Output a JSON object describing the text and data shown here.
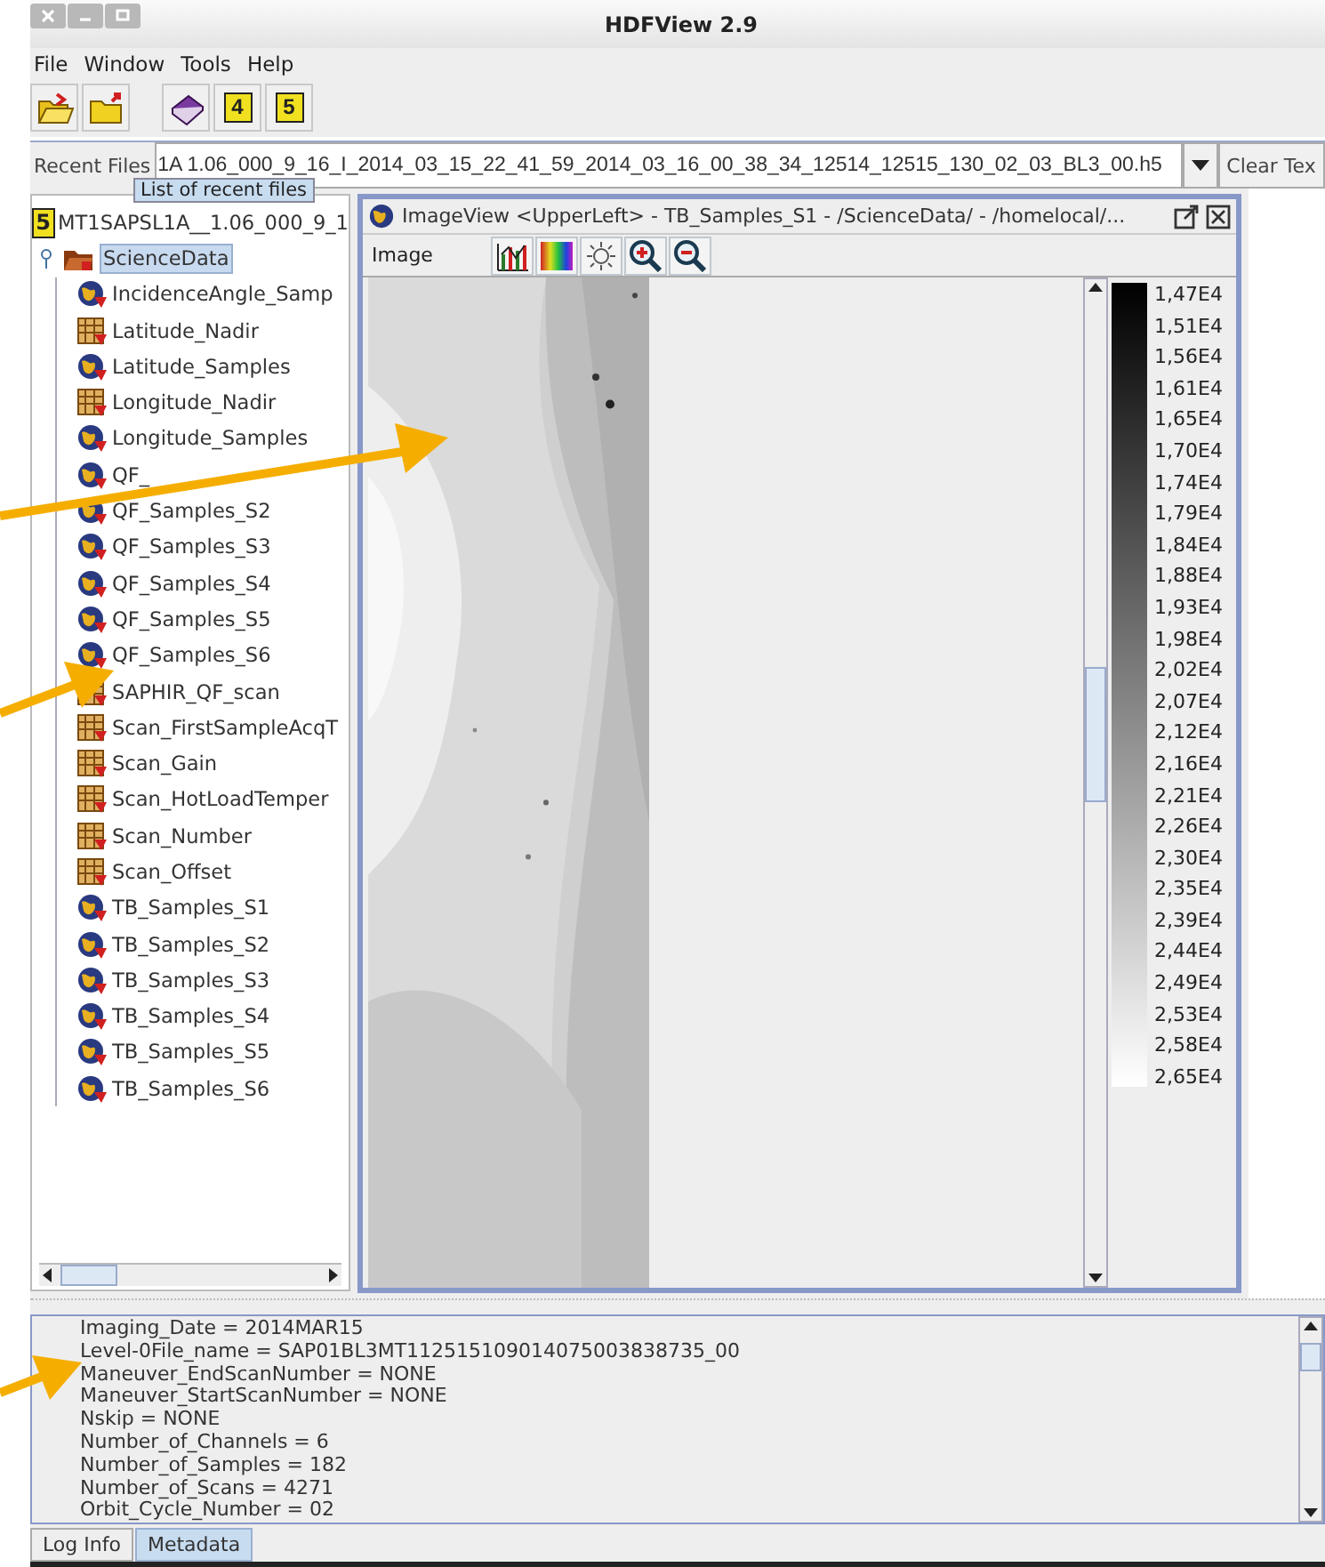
{
  "window": {
    "title": "HDFView 2.9"
  },
  "menu": [
    "File",
    "Window",
    "Tools",
    "Help"
  ],
  "toolbar": [
    {
      "kind": "open"
    },
    {
      "kind": "close"
    },
    {
      "kind": "help"
    },
    {
      "kind": "h4",
      "glyph": "4"
    },
    {
      "kind": "h5",
      "glyph": "5"
    }
  ],
  "recent_files": {
    "label": "Recent Files",
    "value": "1A  1.06_000_9_16_I_2014_03_15_22_41_59_2014_03_16_00_38_34_12514_12515_130_02_03_BL3_00.h5",
    "clear_button": "Clear Tex",
    "tooltip": "List of recent files"
  },
  "tree": {
    "root": {
      "label": "MT1SAPSL1A__1.06_000_9_1",
      "glyph": "5"
    },
    "group": {
      "label": "ScienceData",
      "selected": true,
      "expanded": true
    },
    "children": [
      {
        "label": "IncidenceAngle_Samp"
      },
      {
        "label": "Latitude_Nadir",
        "kind": "table"
      },
      {
        "label": "Latitude_Samples"
      },
      {
        "label": "Longitude_Nadir",
        "kind": "table"
      },
      {
        "label": "Longitude_Samples"
      },
      {
        "label": "QF_"
      },
      {
        "label": "QF_Samples_S2"
      },
      {
        "label": "QF_Samples_S3"
      },
      {
        "label": "QF_Samples_S4"
      },
      {
        "label": "QF_Samples_S5"
      },
      {
        "label": "QF_Samples_S6"
      },
      {
        "label": "SAPHIR_QF_scan",
        "kind": "table"
      },
      {
        "label": "Scan_FirstSampleAcqT",
        "kind": "table"
      },
      {
        "label": "Scan_Gain",
        "kind": "table"
      },
      {
        "label": "Scan_HotLoadTemper",
        "kind": "table"
      },
      {
        "label": "Scan_Number",
        "kind": "table"
      },
      {
        "label": "Scan_Offset",
        "kind": "table"
      },
      {
        "label": "TB_Samples_S1"
      },
      {
        "label": "TB_Samples_S2"
      },
      {
        "label": "TB_Samples_S3"
      },
      {
        "label": "TB_Samples_S4"
      },
      {
        "label": "TB_Samples_S5"
      },
      {
        "label": "TB_Samples_S6"
      }
    ]
  },
  "image_view": {
    "title": "ImageView <UpperLeft>  -  TB_Samples_S1  -  /ScienceData/  -  /homelocal/...",
    "menu": "Image",
    "tools": [
      {
        "kind": "histogram"
      },
      {
        "kind": "palette"
      },
      {
        "kind": "brightness"
      },
      {
        "kind": "zoom-in"
      },
      {
        "kind": "zoom-out"
      }
    ],
    "legend": [
      "1,47E4",
      "1,51E4",
      "1,56E4",
      "1,61E4",
      "1,65E4",
      "1,70E4",
      "1,74E4",
      "1,79E4",
      "1,84E4",
      "1,88E4",
      "1,93E4",
      "1,98E4",
      "2,02E4",
      "2,07E4",
      "2,12E4",
      "2,16E4",
      "2,21E4",
      "2,26E4",
      "2,30E4",
      "2,35E4",
      "2,39E4",
      "2,44E4",
      "2,49E4",
      "2,53E4",
      "2,58E4",
      "2,65E4"
    ]
  },
  "metadata": [
    "Imaging_Date = 2014MAR15",
    "Level-0File_name = SAP01BL3MT112515109014075003838735_00",
    "Maneuver_EndScanNumber = NONE",
    "Maneuver_StartScanNumber = NONE",
    "Nskip = NONE",
    "Number_of_Channels = 6",
    "Number_of_Samples = 182",
    "Number_of_Scans = 4271",
    "Orbit_Cycle_Number = 02"
  ],
  "tabs": [
    {
      "label": "Log Info",
      "selected": false
    },
    {
      "label": "Metadata",
      "selected": true
    }
  ]
}
